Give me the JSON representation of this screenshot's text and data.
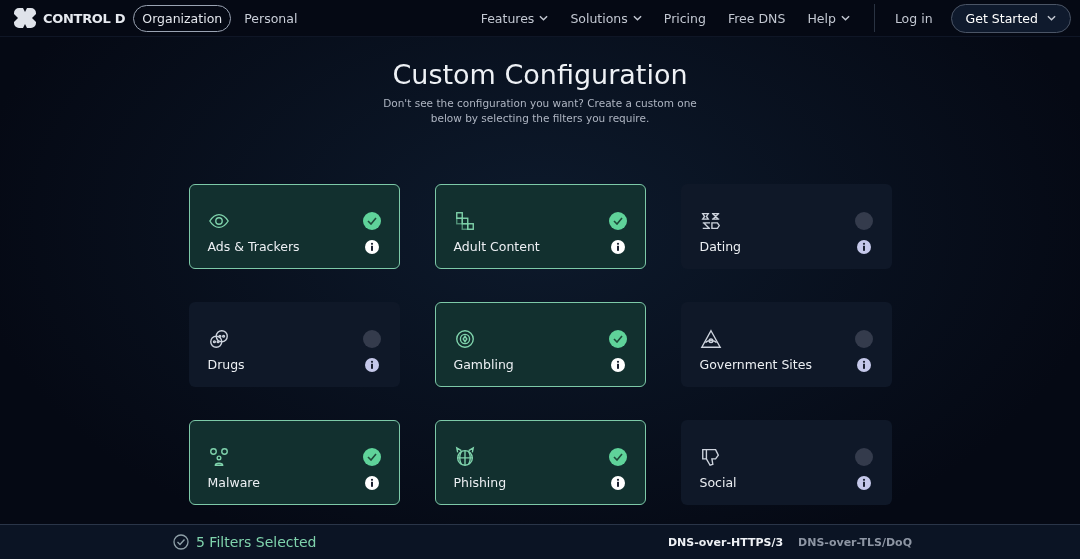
{
  "header": {
    "brand": "CONTROL D",
    "audience_tabs": [
      {
        "label": "Organization",
        "selected": true
      },
      {
        "label": "Personal",
        "selected": false
      }
    ],
    "nav": [
      {
        "label": "Features",
        "dropdown": true
      },
      {
        "label": "Solutions",
        "dropdown": true
      },
      {
        "label": "Pricing",
        "dropdown": false
      },
      {
        "label": "Free DNS",
        "dropdown": false
      },
      {
        "label": "Help",
        "dropdown": true
      }
    ],
    "login": "Log in",
    "cta": "Get Started"
  },
  "title": "Custom Configuration",
  "subtitle": "Don't see the configuration you want? Create a custom one below by selecting the filters you require.",
  "filters": [
    {
      "label": "Ads & Trackers",
      "selected": true
    },
    {
      "label": "Adult Content",
      "selected": true
    },
    {
      "label": "Dating",
      "selected": false
    },
    {
      "label": "Drugs",
      "selected": false
    },
    {
      "label": "Gambling",
      "selected": true
    },
    {
      "label": "Government Sites",
      "selected": false
    },
    {
      "label": "Malware",
      "selected": true
    },
    {
      "label": "Phishing",
      "selected": true
    },
    {
      "label": "Social",
      "selected": false
    }
  ],
  "footer": {
    "summary": "5 Filters Selected",
    "protocols": [
      {
        "label": "DNS-over-HTTPS/3",
        "selected": true
      },
      {
        "label": "DNS-over-TLS/DoQ",
        "selected": false
      }
    ]
  }
}
